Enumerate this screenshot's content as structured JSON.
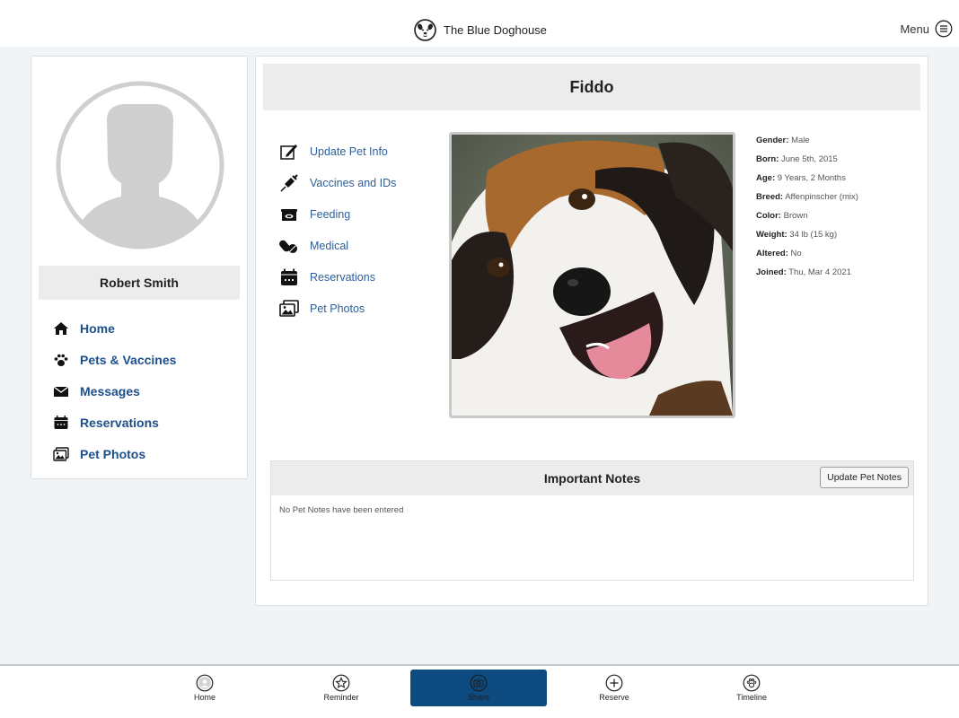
{
  "header": {
    "brand_name": "The Blue Doghouse",
    "menu_label": "Menu"
  },
  "profile": {
    "user_name": "Robert Smith",
    "nav": [
      {
        "label": "Home",
        "icon": "home-icon"
      },
      {
        "label": "Pets & Vaccines",
        "icon": "paw-icon"
      },
      {
        "label": "Messages",
        "icon": "envelope-icon"
      },
      {
        "label": "Reservations",
        "icon": "calendar-icon"
      },
      {
        "label": "Pet Photos",
        "icon": "photos-icon"
      }
    ]
  },
  "pet": {
    "name": "Fiddo",
    "actions": [
      {
        "label": "Update Pet Info",
        "icon": "edit-icon"
      },
      {
        "label": "Vaccines and IDs",
        "icon": "syringe-icon"
      },
      {
        "label": "Feeding",
        "icon": "food-bowl-icon"
      },
      {
        "label": "Medical",
        "icon": "pills-icon"
      },
      {
        "label": "Reservations",
        "icon": "calendar-icon"
      },
      {
        "label": "Pet Photos",
        "icon": "photos-icon"
      }
    ],
    "details": [
      {
        "key": "Gender:",
        "value": "Male"
      },
      {
        "key": "Born:",
        "value": "June 5th, 2015"
      },
      {
        "key": "Age:",
        "value": "9 Years, 2 Months"
      },
      {
        "key": "Breed:",
        "value": "Affenpinscher (mix)"
      },
      {
        "key": "Color:",
        "value": "Brown"
      },
      {
        "key": "Weight:",
        "value": "34 lb (15 kg)"
      },
      {
        "key": "Altered:",
        "value": "No"
      },
      {
        "key": "Joined:",
        "value": "Thu, Mar 4 2021"
      }
    ]
  },
  "notes": {
    "title": "Important Notes",
    "button_label": "Update Pet Notes",
    "empty_text": "No Pet Notes have been entered"
  },
  "bottom_nav": {
    "tabs": [
      {
        "label": "Home",
        "icon": "avatar-icon",
        "active": false
      },
      {
        "label": "Reminder",
        "icon": "star-icon",
        "active": false
      },
      {
        "label": "Share",
        "icon": "camera-icon",
        "active": true
      },
      {
        "label": "Reserve",
        "icon": "plus-circle-icon",
        "active": false
      },
      {
        "label": "Timeline",
        "icon": "paw-circle-icon",
        "active": false
      }
    ]
  },
  "colors": {
    "accent": "#0d4a80",
    "link": "#1d4f8a",
    "page_bg": "#f0f4f7",
    "panel_header": "#ececec"
  }
}
